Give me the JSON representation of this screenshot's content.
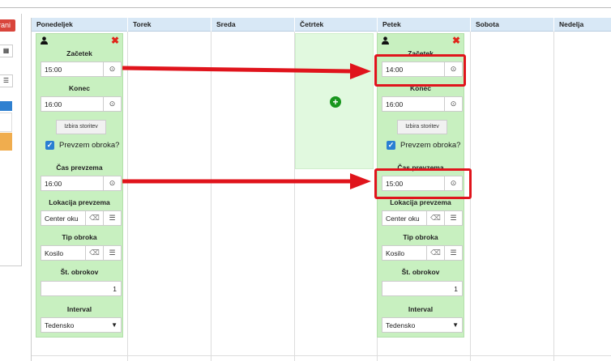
{
  "left_panel": {
    "save_label": "rani"
  },
  "calendar": {
    "days": [
      "Ponedeljek",
      "Torek",
      "Sreda",
      "Četrtek",
      "Petek",
      "Sobota",
      "Nedelja"
    ]
  },
  "card_monday": {
    "start_label": "Začetek",
    "start_value": "15:00",
    "end_label": "Konec",
    "end_value": "16:00",
    "services_button": "Izbira storitev",
    "meal_pickup_label": "Prevzem obroka?",
    "pickup_time_label": "Čas prevzema",
    "pickup_time_value": "16:00",
    "pickup_location_label": "Lokacija prevzema",
    "pickup_location_value": "Center oku",
    "meal_type_label": "Tip obroka",
    "meal_type_value": "Kosilo",
    "meal_count_label": "Št. obrokov",
    "meal_count_value": "1",
    "interval_label": "Interval",
    "interval_value": "Tedensko"
  },
  "card_friday": {
    "start_label": "Začetek",
    "start_value": "14:00",
    "end_label": "Konec",
    "end_value": "16:00",
    "services_button": "Izbira storitev",
    "meal_pickup_label": "Prevzem obroka?",
    "pickup_time_label": "Čas prevzema",
    "pickup_time_value": "15:00",
    "pickup_location_label": "Lokacija prevzema",
    "pickup_location_value": "Center oku",
    "meal_type_label": "Tip obroka",
    "meal_type_value": "Kosilo",
    "meal_count_label": "Št. obrokov",
    "meal_count_value": "1",
    "interval_label": "Interval",
    "interval_value": "Tedensko"
  },
  "icons": {
    "user": "user-icon",
    "close": "close-icon",
    "clock": "clock-icon",
    "eraser": "eraser-icon",
    "list": "list-icon",
    "plus": "plus-circle-icon",
    "calendar": "calendar-icon",
    "caret": "chevron-down-icon"
  },
  "colors": {
    "card_bg": "#c8f0c0",
    "drop_zone_bg": "#e1f9df",
    "header_bg": "#d8e8f6",
    "annotation_red": "#e0141c",
    "checkbox_blue": "#2a7fd3",
    "plus_green": "#18961d"
  }
}
